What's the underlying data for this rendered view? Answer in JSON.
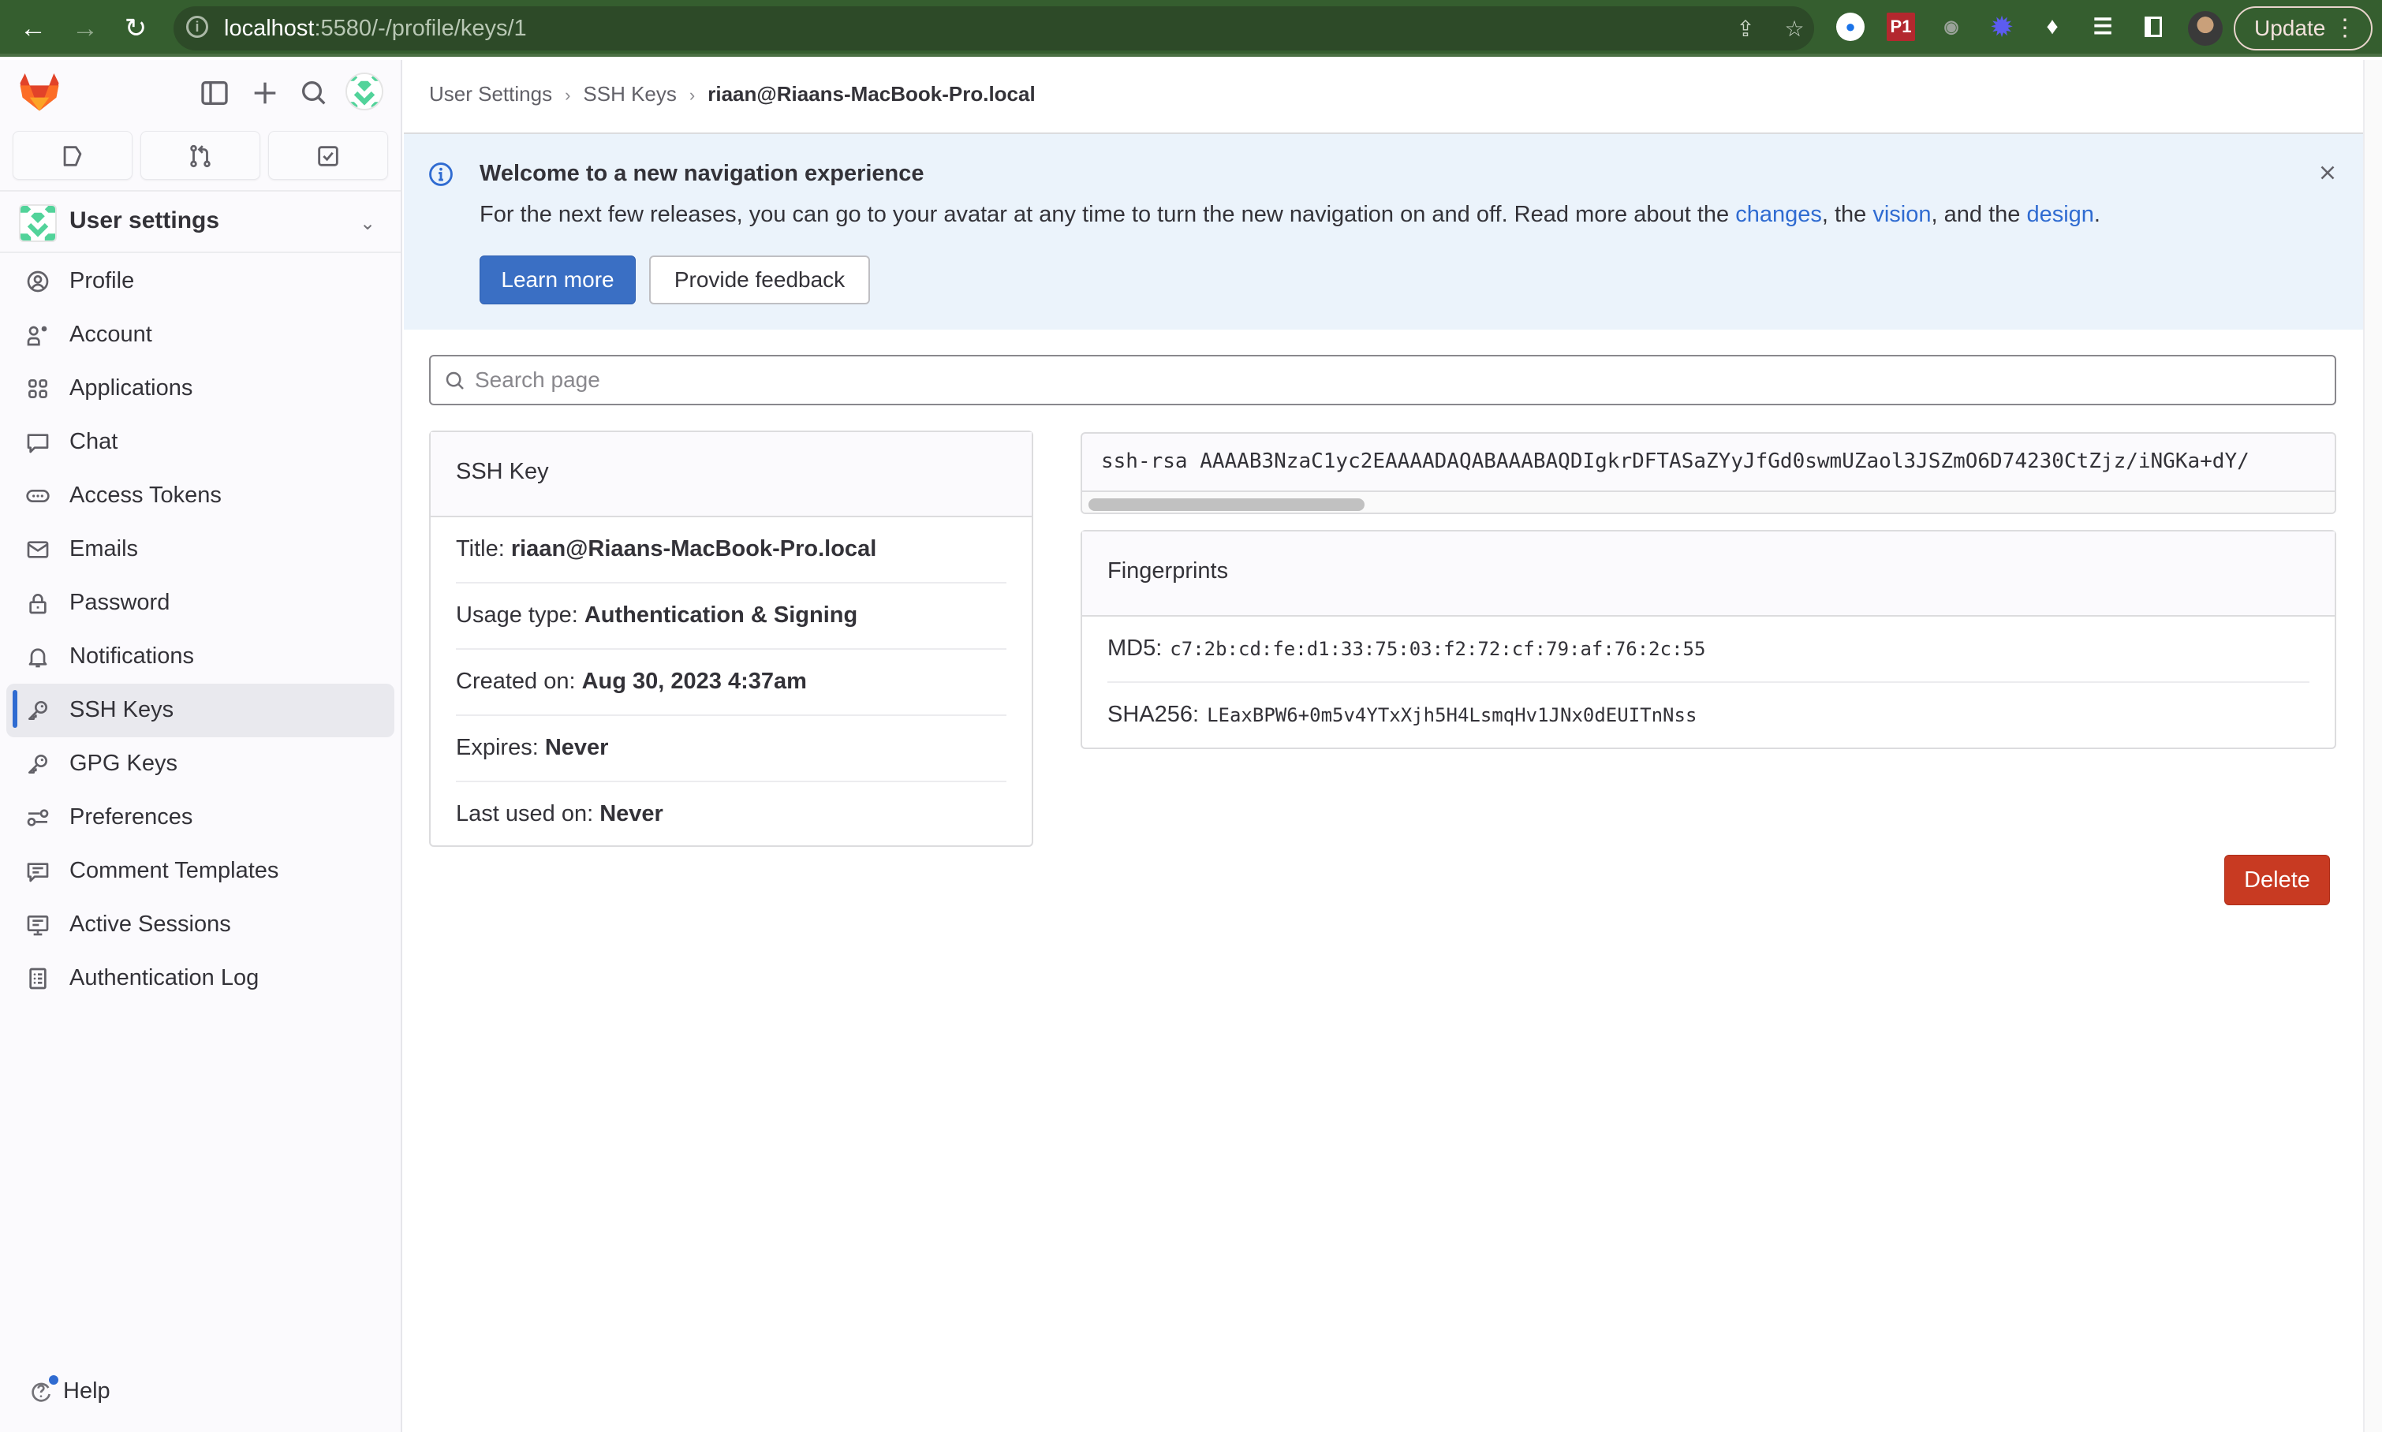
{
  "browser": {
    "url_host": "localhost",
    "url_path": ":5580/-/profile/keys/1",
    "update_label": "Update",
    "extensions": [
      {
        "name": "1password-icon"
      },
      {
        "name": "p1-extension-icon",
        "label": "P1"
      },
      {
        "name": "camera-extension-icon"
      },
      {
        "name": "sparkle-extension-icon"
      },
      {
        "name": "puzzle-extensions-icon"
      },
      {
        "name": "media-controls-icon"
      },
      {
        "name": "side-panel-icon"
      }
    ]
  },
  "sidebar": {
    "context_title": "User settings",
    "items": [
      {
        "label": "Profile",
        "icon": "profile-icon"
      },
      {
        "label": "Account",
        "icon": "account-icon"
      },
      {
        "label": "Applications",
        "icon": "applications-icon"
      },
      {
        "label": "Chat",
        "icon": "chat-icon"
      },
      {
        "label": "Access Tokens",
        "icon": "token-icon"
      },
      {
        "label": "Emails",
        "icon": "mail-icon"
      },
      {
        "label": "Password",
        "icon": "lock-icon"
      },
      {
        "label": "Notifications",
        "icon": "bell-icon"
      },
      {
        "label": "SSH Keys",
        "icon": "key-icon",
        "active": true
      },
      {
        "label": "GPG Keys",
        "icon": "key-icon"
      },
      {
        "label": "Preferences",
        "icon": "preferences-icon"
      },
      {
        "label": "Comment Templates",
        "icon": "comment-template-icon"
      },
      {
        "label": "Active Sessions",
        "icon": "monitor-icon"
      },
      {
        "label": "Authentication Log",
        "icon": "log-icon"
      }
    ],
    "help_label": "Help"
  },
  "breadcrumb": {
    "items": [
      "User Settings",
      "SSH Keys"
    ],
    "current": "riaan@Riaans-MacBook-Pro.local"
  },
  "banner": {
    "title": "Welcome to a new navigation experience",
    "body_prefix": "For the next few releases, you can go to your avatar at any time to turn the new navigation on and off. Read more about the ",
    "link_changes": "changes",
    "sep1": ", the ",
    "link_vision": "vision",
    "sep2": ", and the ",
    "link_design": "design",
    "suffix": ".",
    "learn_more": "Learn more",
    "provide_feedback": "Provide feedback"
  },
  "search": {
    "placeholder": "Search page",
    "value": ""
  },
  "ssh_key": {
    "header": "SSH Key",
    "title_label": "Title:",
    "title_value": "riaan@Riaans-MacBook-Pro.local",
    "usage_label": "Usage type:",
    "usage_value": "Authentication & Signing",
    "created_label": "Created on:",
    "created_value": "Aug 30, 2023 4:37am",
    "expires_label": "Expires:",
    "expires_value": "Never",
    "last_used_label": "Last used on:",
    "last_used_value": "Never",
    "public_key": "ssh-rsa AAAAB3NzaC1yc2EAAAADAQABAAABAQDIgkrDFTASaZYyJfGd0swmUZaol3JSZmO6D74230CtZjz/iNGKa+dY/"
  },
  "fingerprints": {
    "header": "Fingerprints",
    "md5_label": "MD5:",
    "md5_value": "c7:2b:cd:fe:d1:33:75:03:f2:72:cf:79:af:76:2c:55",
    "sha256_label": "SHA256:",
    "sha256_value": "LEaxBPW6+0m5v4YTxXjh5H4LsmqHv1JNx0dEUITnNss"
  },
  "actions": {
    "delete_label": "Delete"
  }
}
